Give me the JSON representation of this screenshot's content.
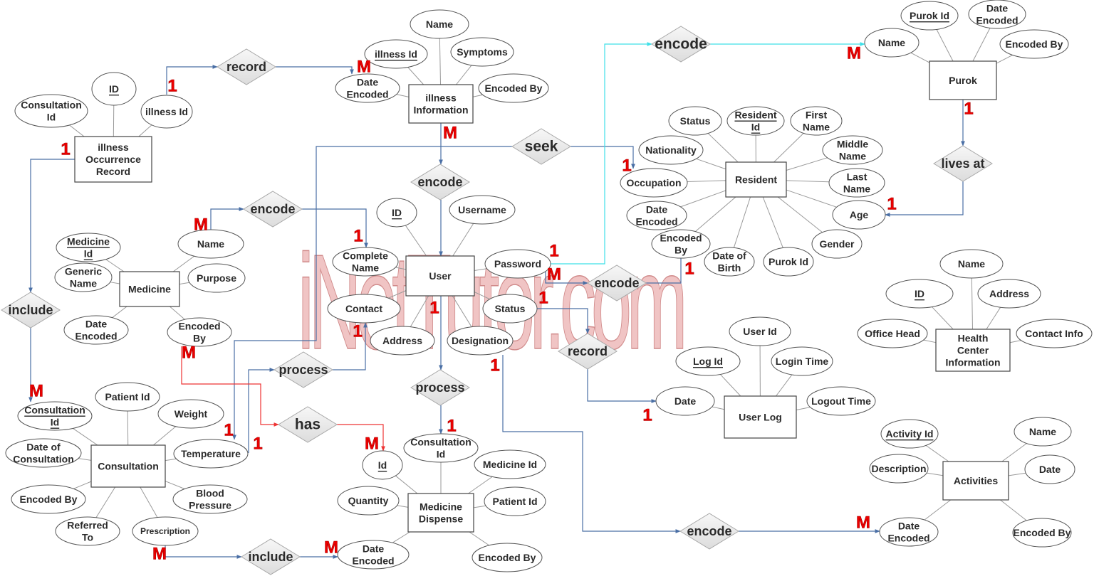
{
  "watermark": "iNetTutor.com",
  "colors": {
    "relationship_line": "#4a6fa5",
    "cyan_line": "#3fe0e8",
    "red_line": "#ee3333",
    "cardinality": "#ee0000"
  },
  "entities": [
    {
      "id": "illness_occurrence",
      "label": [
        "illness",
        "Occurrence",
        "Record"
      ]
    },
    {
      "id": "illness_info",
      "label": [
        "illness",
        "Information"
      ]
    },
    {
      "id": "purok",
      "label": [
        "Purok"
      ]
    },
    {
      "id": "resident",
      "label": [
        "Resident"
      ]
    },
    {
      "id": "medicine",
      "label": [
        "Medicine"
      ]
    },
    {
      "id": "user",
      "label": [
        "User"
      ]
    },
    {
      "id": "health_center",
      "label": [
        "Health",
        "Center",
        "Information"
      ]
    },
    {
      "id": "user_log",
      "label": [
        "User Log"
      ]
    },
    {
      "id": "consultation",
      "label": [
        "Consultation"
      ]
    },
    {
      "id": "medicine_dispense",
      "label": [
        "Medicine",
        "Dispense"
      ]
    },
    {
      "id": "activities",
      "label": [
        "Activities"
      ]
    }
  ],
  "attributes": {
    "illness_occurrence": [
      {
        "label": [
          "Consultation",
          "Id"
        ]
      },
      {
        "label": [
          "ID"
        ],
        "key": true
      },
      {
        "label": [
          "illness Id"
        ]
      }
    ],
    "illness_info": [
      {
        "label": [
          "Name"
        ]
      },
      {
        "label": [
          "illness Id"
        ],
        "key": true
      },
      {
        "label": [
          "Symptoms"
        ]
      },
      {
        "label": [
          "Date",
          "Encoded"
        ]
      },
      {
        "label": [
          "Encoded By"
        ]
      }
    ],
    "purok": [
      {
        "label": [
          "Purok Id"
        ],
        "key": true
      },
      {
        "label": [
          "Date",
          "Encoded"
        ]
      },
      {
        "label": [
          "Name"
        ]
      },
      {
        "label": [
          "Encoded By"
        ]
      }
    ],
    "resident": [
      {
        "label": [
          "Status"
        ]
      },
      {
        "label": [
          "Resident",
          "Id"
        ],
        "key": true
      },
      {
        "label": [
          "First",
          "Name"
        ]
      },
      {
        "label": [
          "Nationality"
        ]
      },
      {
        "label": [
          "Middle",
          "Name"
        ]
      },
      {
        "label": [
          "Occupation"
        ]
      },
      {
        "label": [
          "Last",
          "Name"
        ]
      },
      {
        "label": [
          "Date",
          "Encoded"
        ]
      },
      {
        "label": [
          "Age"
        ]
      },
      {
        "label": [
          "Encoded",
          "By"
        ]
      },
      {
        "label": [
          "Date of",
          "Birth"
        ]
      },
      {
        "label": [
          "Purok Id"
        ]
      },
      {
        "label": [
          "Gender"
        ]
      }
    ],
    "medicine": [
      {
        "label": [
          "Medicine",
          "Id"
        ],
        "key": true
      },
      {
        "label": [
          "Name"
        ]
      },
      {
        "label": [
          "Generic",
          "Name"
        ]
      },
      {
        "label": [
          "Purpose"
        ]
      },
      {
        "label": [
          "Date",
          "Encoded"
        ]
      },
      {
        "label": [
          "Encoded",
          "By"
        ]
      }
    ],
    "user": [
      {
        "label": [
          "ID"
        ],
        "key": true
      },
      {
        "label": [
          "Username"
        ]
      },
      {
        "label": [
          "Complete",
          "Name"
        ]
      },
      {
        "label": [
          "Password"
        ]
      },
      {
        "label": [
          "Contact"
        ]
      },
      {
        "label": [
          "Status"
        ]
      },
      {
        "label": [
          "Address"
        ]
      },
      {
        "label": [
          "Designation"
        ]
      }
    ],
    "health_center": [
      {
        "label": [
          "Name"
        ]
      },
      {
        "label": [
          "ID"
        ],
        "key": true
      },
      {
        "label": [
          "Address"
        ]
      },
      {
        "label": [
          "Office Head"
        ]
      },
      {
        "label": [
          "Contact Info"
        ]
      }
    ],
    "user_log": [
      {
        "label": [
          "User Id"
        ]
      },
      {
        "label": [
          "Log Id"
        ],
        "key": true
      },
      {
        "label": [
          "Login Time"
        ]
      },
      {
        "label": [
          "Date"
        ]
      },
      {
        "label": [
          "Logout Time"
        ]
      }
    ],
    "consultation": [
      {
        "label": [
          "Patient Id"
        ]
      },
      {
        "label": [
          "Consultation",
          "Id"
        ],
        "key": true
      },
      {
        "label": [
          "Weight"
        ]
      },
      {
        "label": [
          "Date of",
          "Consultation"
        ]
      },
      {
        "label": [
          "Temperature"
        ]
      },
      {
        "label": [
          "Encoded By"
        ]
      },
      {
        "label": [
          "Blood",
          "Pressure"
        ]
      },
      {
        "label": [
          "Referred",
          "To"
        ]
      },
      {
        "label": [
          "Prescription"
        ]
      }
    ],
    "medicine_dispense": [
      {
        "label": [
          "Consultation",
          "Id"
        ]
      },
      {
        "label": [
          "Id"
        ],
        "key": true
      },
      {
        "label": [
          "Medicine Id"
        ]
      },
      {
        "label": [
          "Quantity"
        ]
      },
      {
        "label": [
          "Patient Id"
        ]
      },
      {
        "label": [
          "Date",
          "Encoded"
        ]
      },
      {
        "label": [
          "Encoded By"
        ]
      }
    ],
    "activities": [
      {
        "label": [
          "Activity Id"
        ],
        "key": true
      },
      {
        "label": [
          "Name"
        ]
      },
      {
        "label": [
          "Description"
        ]
      },
      {
        "label": [
          "Date"
        ]
      },
      {
        "label": [
          "Date",
          "Encoded"
        ]
      },
      {
        "label": [
          "Encoded By"
        ]
      }
    ]
  },
  "relationships": [
    {
      "id": "rel_record_illness",
      "label": "record"
    },
    {
      "id": "rel_encode_purok",
      "label": "encode"
    },
    {
      "id": "rel_seek",
      "label": "seek"
    },
    {
      "id": "rel_encode_illness",
      "label": "encode"
    },
    {
      "id": "rel_lives_at",
      "label": "lives at"
    },
    {
      "id": "rel_encode_medicine",
      "label": "encode"
    },
    {
      "id": "rel_include_consult",
      "label": "include"
    },
    {
      "id": "rel_encode_resident",
      "label": "encode"
    },
    {
      "id": "rel_record_log",
      "label": "record"
    },
    {
      "id": "rel_process_contact",
      "label": "process"
    },
    {
      "id": "rel_process_dispense",
      "label": "process"
    },
    {
      "id": "rel_has",
      "label": "has"
    },
    {
      "id": "rel_include_dispense",
      "label": "include"
    },
    {
      "id": "rel_encode_activities",
      "label": "encode"
    }
  ],
  "cardinalities": [
    "1",
    "M",
    "M",
    "M",
    "1",
    "1",
    "1",
    "1",
    "M",
    "1",
    "1",
    "M",
    "1",
    "1",
    "1",
    "M",
    "1",
    "1",
    "1",
    "M",
    "1",
    "1",
    "1",
    "M",
    "M",
    "M",
    "M",
    "1",
    "M",
    "1",
    "M",
    "M"
  ]
}
